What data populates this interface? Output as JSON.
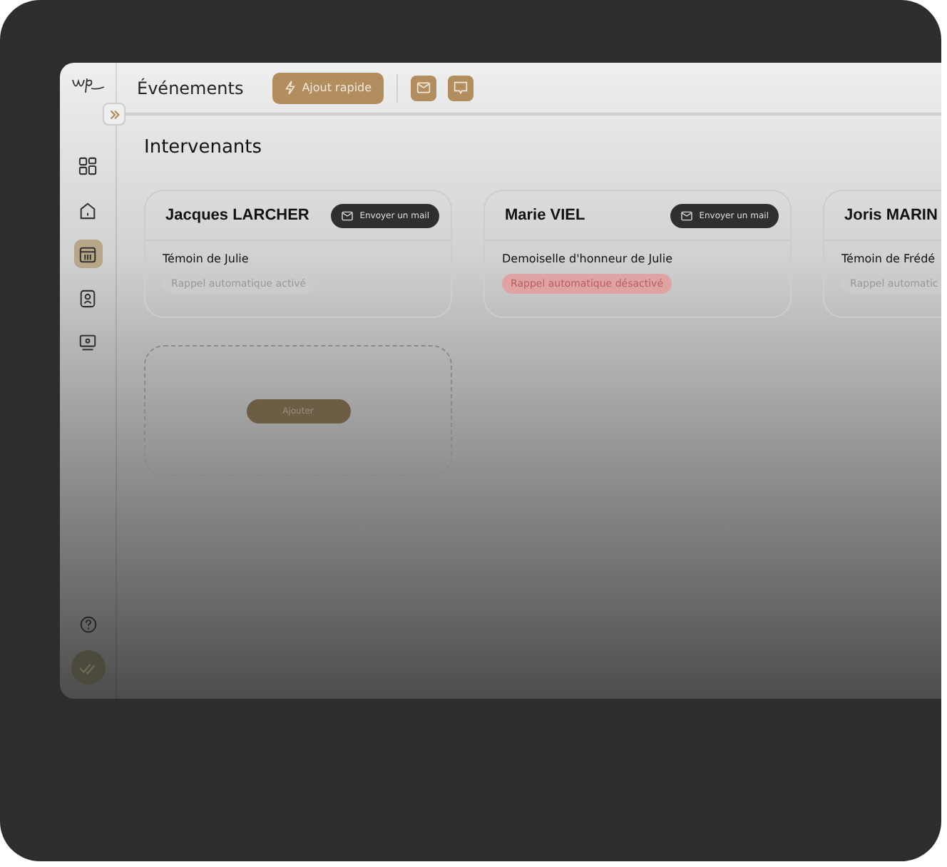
{
  "header": {
    "title": "Événements",
    "quick_add": "Ajout rapide"
  },
  "sidebar": {
    "items": [
      {
        "kind": "grid",
        "selected": false
      },
      {
        "kind": "home",
        "selected": false
      },
      {
        "kind": "calendar",
        "selected": true
      },
      {
        "kind": "contact",
        "selected": false
      },
      {
        "kind": "monitor",
        "selected": false
      }
    ]
  },
  "section_title": "Intervenants",
  "speakers": [
    {
      "name": "Jacques LARCHER",
      "mail_button": "Envoyer un mail",
      "role": "Témoin de Julie",
      "reminder": "Rappel automatique activé",
      "reminder_active": true
    },
    {
      "name": "Marie VIEL",
      "mail_button": "Envoyer un mail",
      "role": "Demoiselle d'honneur de Julie",
      "reminder": "Rappel automatique désactivé",
      "reminder_active": false
    },
    {
      "name": "Joris MARIN",
      "role": "Témoin de Frédé",
      "reminder": "Rappel automatic",
      "reminder_active": true
    }
  ],
  "add_button": "Ajouter"
}
